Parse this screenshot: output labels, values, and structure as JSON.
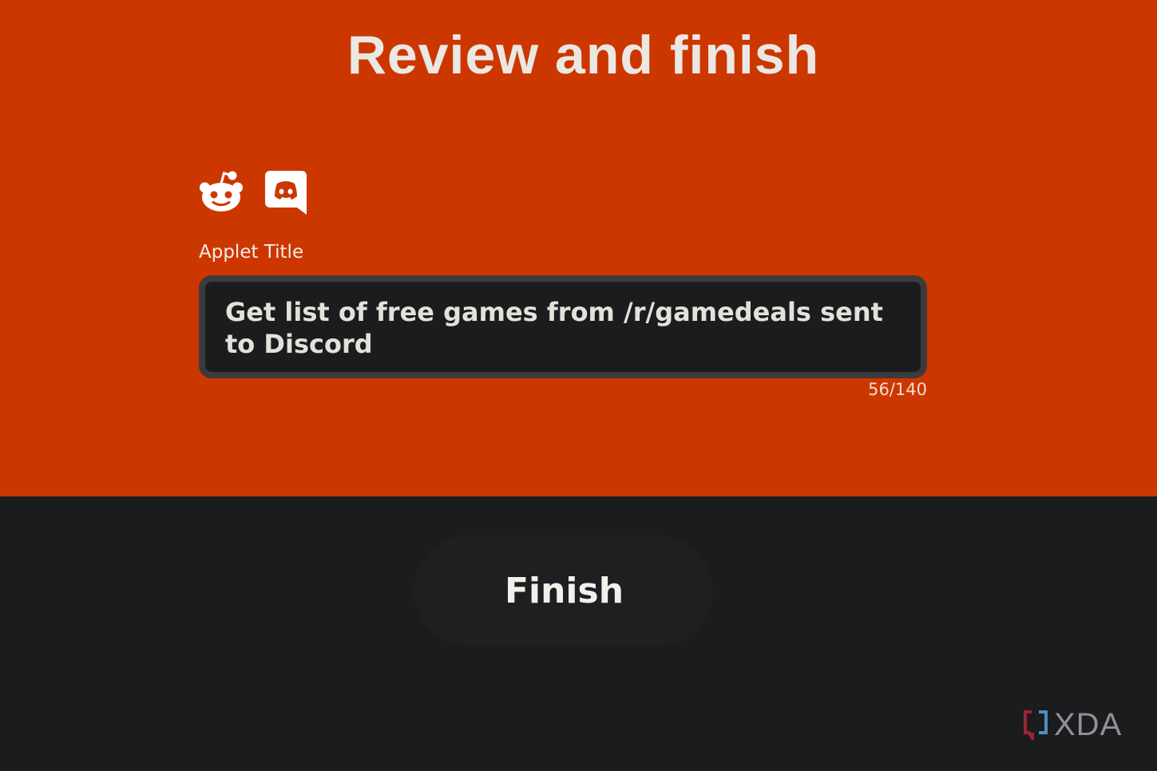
{
  "header": {
    "title": "Review and finish"
  },
  "services": {
    "trigger_icon": "reddit-icon",
    "action_icon": "discord-icon"
  },
  "applet_title": {
    "label": "Applet Title",
    "value": "Get list of free games from /r/gamedeals sent to Discord",
    "char_count": "56/140"
  },
  "finish_button": {
    "label": "Finish"
  },
  "watermark": {
    "text": "XDA"
  },
  "colors": {
    "top_background": "#cc3700",
    "bottom_background": "#1b1c1e"
  }
}
